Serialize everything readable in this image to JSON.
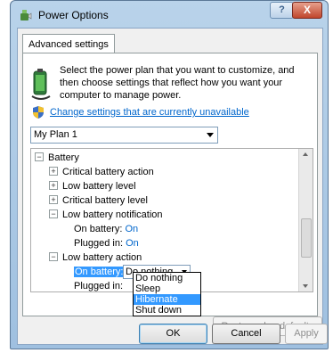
{
  "window": {
    "title": "Power Options",
    "help_label": "?",
    "close_label": "X"
  },
  "tab": {
    "label": "Advanced settings"
  },
  "intro": {
    "text": "Select the power plan that you want to customize, and then choose settings that reflect how you want your computer to manage power.",
    "change_link": "Change settings that are currently unavailable"
  },
  "plan_select": {
    "value": "My Plan 1"
  },
  "tree": {
    "battery": "Battery",
    "critical_action": "Critical battery action",
    "low_level": "Low battery level",
    "critical_level": "Critical battery level",
    "low_notification": "Low battery notification",
    "notif_on_battery_label": "On battery:",
    "notif_on_battery_value": "On",
    "notif_plugged_label": "Plugged in:",
    "notif_plugged_value": "On",
    "low_action": "Low battery action",
    "action_on_battery_label": "On battery:",
    "action_on_battery_value": "Do nothing",
    "action_plugged_label": "Plugged in:",
    "expand_minus": "−",
    "expand_plus": "+"
  },
  "dropdown_options": [
    "Do nothing",
    "Sleep",
    "Hibernate",
    "Shut down"
  ],
  "buttons": {
    "restore": "Restore plan defaults",
    "ok": "OK",
    "cancel": "Cancel",
    "apply": "Apply"
  },
  "icons": {
    "title_icon": "power-options-icon",
    "intro_icon": "battery-plug-icon",
    "shield_icon": "uac-shield-icon"
  }
}
